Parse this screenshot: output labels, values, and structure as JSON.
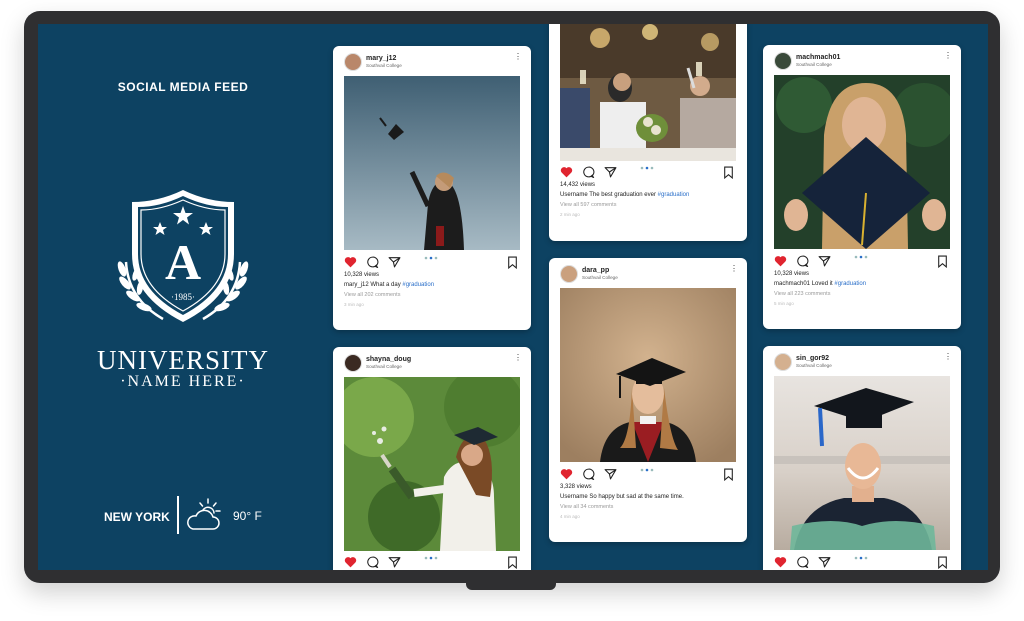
{
  "sidebar": {
    "feed_title": "SOCIAL MEDIA FEED",
    "crest_letter": "A",
    "crest_year": "·1985·",
    "university_line1": "UNIVERSITY",
    "university_line2": "·NAME HERE·",
    "city": "NEW YORK",
    "temperature": "90° F",
    "weather_icon": "cloud-sun-icon"
  },
  "colors": {
    "screen_bg": "#0d4262",
    "heart": "#e0242f",
    "hashtag": "#2a6fc9"
  },
  "posts": [
    {
      "username": "mary_j12",
      "college": "Southvail College",
      "views": "10,328 views",
      "caption_user": "mary_j12",
      "caption_text": "What a day ",
      "hashtag": "#graduation",
      "comments": "View all 202 comments",
      "time": "3 min ago"
    },
    {
      "username": "",
      "college": "",
      "views": "14,432 views",
      "caption_user": "Username",
      "caption_text": "The best graduation ever ",
      "hashtag": "#graduation",
      "comments": "View all 597 comments",
      "time": "2 min ago"
    },
    {
      "username": "machmach01",
      "college": "Southvail College",
      "views": "10,328 views",
      "caption_user": "machmach01",
      "caption_text": "Loved it ",
      "hashtag": "#graduation",
      "comments": "View all 223 comments",
      "time": "5 min ago"
    },
    {
      "username": "shayna_doug",
      "college": "Southvail College",
      "views": "",
      "caption_user": "",
      "caption_text": "",
      "hashtag": "",
      "comments": "",
      "time": ""
    },
    {
      "username": "dara_pp",
      "college": "Southvail College",
      "views": "3,328 views",
      "caption_user": "Username",
      "caption_text": "So happy but sad at the same time.",
      "hashtag": "",
      "comments": "View all 34 comments",
      "time": "4 min ago"
    },
    {
      "username": "sin_gor92",
      "college": "Southvail College",
      "views": "",
      "caption_user": "",
      "caption_text": "",
      "hashtag": "",
      "comments": "",
      "time": ""
    }
  ]
}
